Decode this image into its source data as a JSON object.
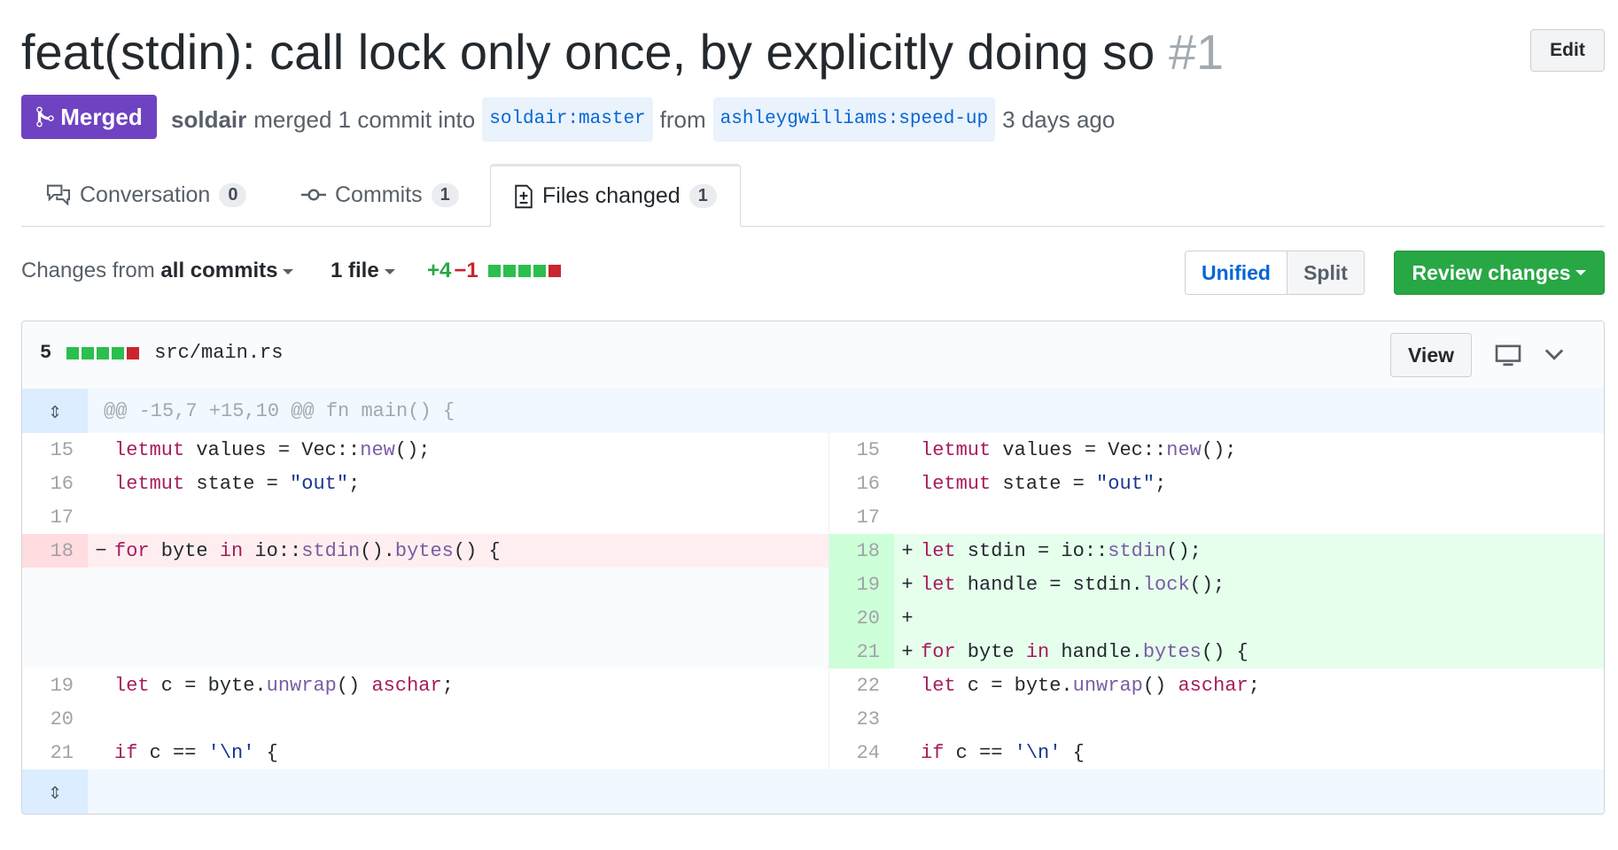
{
  "pr": {
    "title": "feat(stdin): call lock only once, by explicitly doing so",
    "number": "#1",
    "edit_label": "Edit",
    "state": "Merged",
    "author": "soldair",
    "merged_text": "merged 1 commit into",
    "base_branch": "soldair:master",
    "from_text": "from",
    "head_branch": "ashleygwilliams:speed-up",
    "time": "3 days ago"
  },
  "tabs": [
    {
      "label": "Conversation",
      "count": "0",
      "icon": "comment-discussion-icon"
    },
    {
      "label": "Commits",
      "count": "1",
      "icon": "git-commit-icon"
    },
    {
      "label": "Files changed",
      "count": "1",
      "icon": "file-diff-icon"
    }
  ],
  "toolbar": {
    "changes_prefix": "Changes from",
    "changes_value": "all commits",
    "files": "1 file",
    "additions": "+4",
    "deletions": "−1",
    "unified": "Unified",
    "split": "Split",
    "review": "Review changes"
  },
  "file": {
    "changes": "5",
    "path": "src/main.rs",
    "view_label": "View"
  },
  "diff": {
    "hunk_header": "@@ -15,7 +15,10 @@ fn main() {",
    "left_numbers": [
      "15",
      "16",
      "17",
      "18",
      "19",
      "20",
      "21"
    ],
    "right_numbers": [
      "15",
      "16",
      "17",
      "18",
      "19",
      "20",
      "21",
      "22",
      "23",
      "24"
    ],
    "left_marker": "−",
    "right_marker": "+"
  },
  "colors": {
    "merged": "#6f42c1",
    "addition": "#2cbe4e",
    "deletion": "#cb2431",
    "link": "#0366d6",
    "review_button": "#28a745"
  }
}
